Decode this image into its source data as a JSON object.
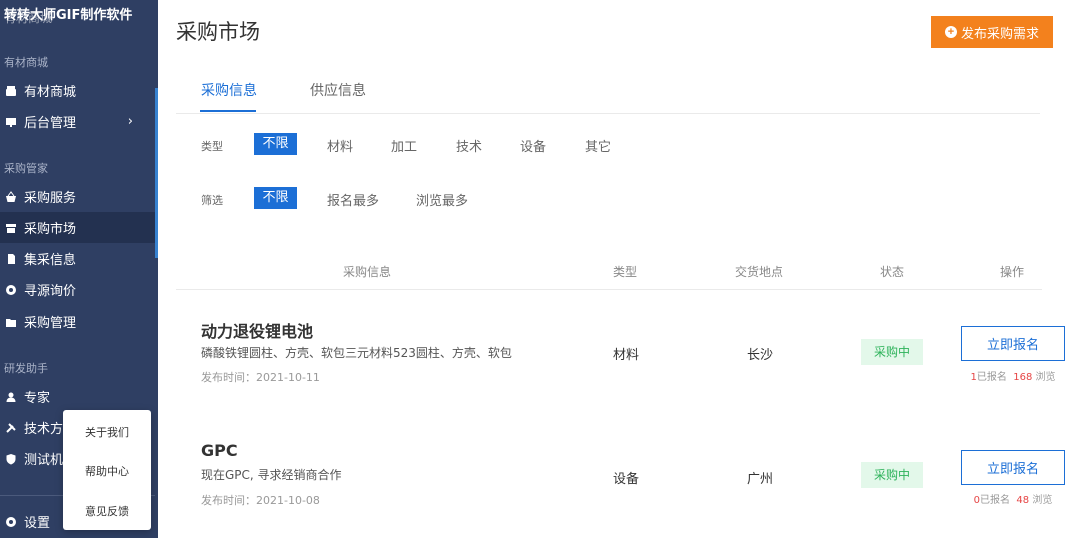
{
  "sidebar": {
    "brand": "转转大师GIF制作软件",
    "brand_sub": "有材商城",
    "section1": "有材商城",
    "section2": "采购管家",
    "section3": "研发助手",
    "items": [
      {
        "label": "有材商城",
        "icon": "shop-icon"
      },
      {
        "label": "后台管理",
        "icon": "monitor-icon"
      },
      {
        "label": "采购服务",
        "icon": "basket-icon"
      },
      {
        "label": "采购市场",
        "icon": "store-icon"
      },
      {
        "label": "集采信息",
        "icon": "document-icon"
      },
      {
        "label": "寻源询价",
        "icon": "target-icon"
      },
      {
        "label": "采购管理",
        "icon": "folder-icon"
      },
      {
        "label": "专家",
        "icon": "user-icon"
      },
      {
        "label": "技术方案",
        "icon": "tools-icon"
      },
      {
        "label": "测试机构",
        "icon": "shield-icon"
      },
      {
        "label": "设置",
        "icon": "gear-icon"
      }
    ],
    "chevron": "›"
  },
  "popover": {
    "items": [
      "关于我们",
      "帮助中心",
      "意见反馈"
    ]
  },
  "main": {
    "title": "采购市场",
    "publish_label": "发布采购需求",
    "tabs": [
      "采购信息",
      "供应信息"
    ],
    "filters": {
      "type_label": "类型",
      "type_options": [
        "不限",
        "材料",
        "加工",
        "技术",
        "设备",
        "其它"
      ],
      "sort_label": "筛选",
      "sort_options": [
        "不限",
        "报名最多",
        "浏览最多"
      ]
    },
    "table": {
      "headers": [
        "采购信息",
        "类型",
        "交货地点",
        "状态",
        "操作"
      ],
      "rows": [
        {
          "title": "动力退役锂电池",
          "desc": "磷酸铁锂圆柱、方壳、软包三元材料523圆柱、方壳、软包",
          "time": "发布时间：2021-10-11",
          "type": "材料",
          "location": "长沙",
          "status": "采购中",
          "action": "立即报名",
          "signups": "1",
          "signups_label": "已报名",
          "views": "168",
          "views_label": "浏览"
        },
        {
          "title": "GPC",
          "desc": "现在GPC, 寻求经销商合作",
          "time": "发布时间：2021-10-08",
          "type": "设备",
          "location": "广州",
          "status": "采购中",
          "action": "立即报名",
          "signups": "0",
          "signups_label": "已报名",
          "views": "48",
          "views_label": "浏览"
        }
      ]
    }
  },
  "colors": {
    "sidebar_bg": "#2f3f63",
    "accent": "#1c6fd6",
    "publish": "#f3811d",
    "status_green": "#2db25a"
  }
}
